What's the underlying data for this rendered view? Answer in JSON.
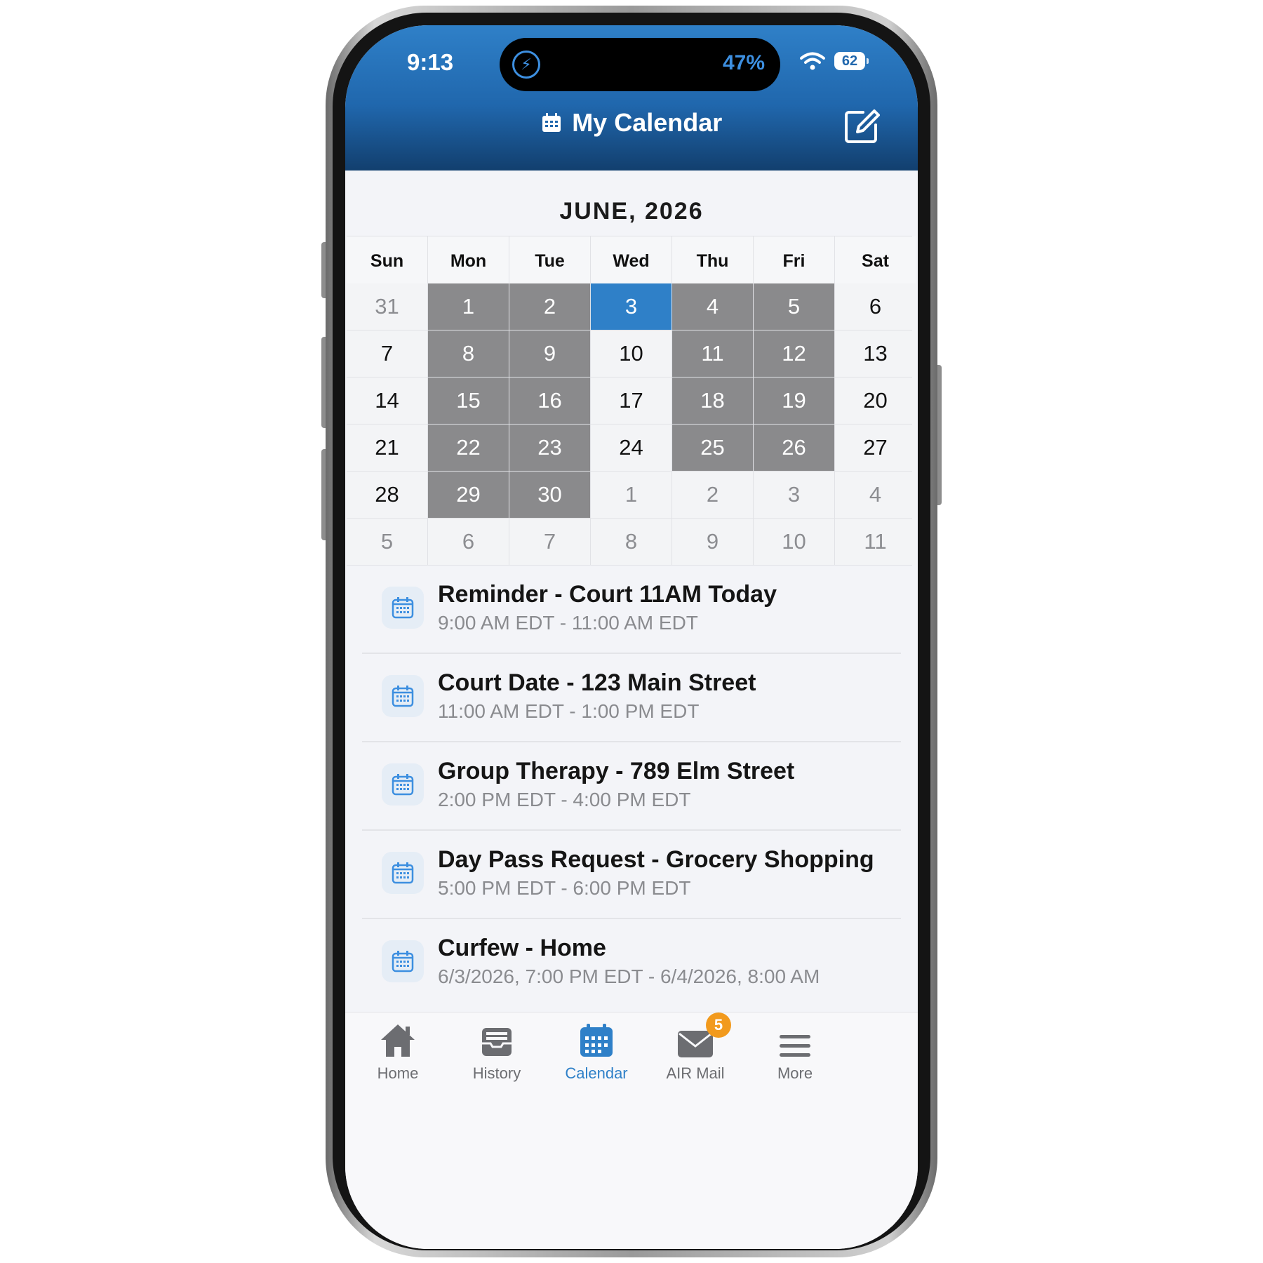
{
  "status": {
    "time": "9:13",
    "battery_pct": "47%",
    "battery_level": "62"
  },
  "header": {
    "title": "My Calendar"
  },
  "calendar": {
    "month": "JUNE, 2026",
    "weekdays": [
      "Sun",
      "Mon",
      "Tue",
      "Wed",
      "Thu",
      "Fri",
      "Sat"
    ],
    "weeks": [
      [
        {
          "d": "31",
          "s": "out"
        },
        {
          "d": "1",
          "s": "busy"
        },
        {
          "d": "2",
          "s": "busy"
        },
        {
          "d": "3",
          "s": "sel"
        },
        {
          "d": "4",
          "s": "busy"
        },
        {
          "d": "5",
          "s": "busy"
        },
        {
          "d": "6",
          "s": ""
        }
      ],
      [
        {
          "d": "7",
          "s": ""
        },
        {
          "d": "8",
          "s": "busy"
        },
        {
          "d": "9",
          "s": "busy"
        },
        {
          "d": "10",
          "s": ""
        },
        {
          "d": "11",
          "s": "busy"
        },
        {
          "d": "12",
          "s": "busy"
        },
        {
          "d": "13",
          "s": ""
        }
      ],
      [
        {
          "d": "14",
          "s": ""
        },
        {
          "d": "15",
          "s": "busy"
        },
        {
          "d": "16",
          "s": "busy"
        },
        {
          "d": "17",
          "s": ""
        },
        {
          "d": "18",
          "s": "busy"
        },
        {
          "d": "19",
          "s": "busy"
        },
        {
          "d": "20",
          "s": ""
        }
      ],
      [
        {
          "d": "21",
          "s": ""
        },
        {
          "d": "22",
          "s": "busy"
        },
        {
          "d": "23",
          "s": "busy"
        },
        {
          "d": "24",
          "s": ""
        },
        {
          "d": "25",
          "s": "busy"
        },
        {
          "d": "26",
          "s": "busy"
        },
        {
          "d": "27",
          "s": ""
        }
      ],
      [
        {
          "d": "28",
          "s": ""
        },
        {
          "d": "29",
          "s": "busy"
        },
        {
          "d": "30",
          "s": "busy"
        },
        {
          "d": "1",
          "s": "out"
        },
        {
          "d": "2",
          "s": "out"
        },
        {
          "d": "3",
          "s": "out"
        },
        {
          "d": "4",
          "s": "out"
        }
      ],
      [
        {
          "d": "5",
          "s": "out"
        },
        {
          "d": "6",
          "s": "out"
        },
        {
          "d": "7",
          "s": "out"
        },
        {
          "d": "8",
          "s": "out"
        },
        {
          "d": "9",
          "s": "out"
        },
        {
          "d": "10",
          "s": "out"
        },
        {
          "d": "11",
          "s": "out"
        }
      ]
    ]
  },
  "events": [
    {
      "title": "Reminder - Court 11AM Today",
      "time": "9:00 AM EDT - 11:00 AM EDT"
    },
    {
      "title": "Court Date - 123 Main Street",
      "time": "11:00 AM EDT - 1:00 PM EDT"
    },
    {
      "title": "Group Therapy - 789 Elm Street",
      "time": "2:00 PM EDT - 4:00 PM EDT"
    },
    {
      "title": "Day Pass Request - Grocery Shopping",
      "time": "5:00 PM EDT - 6:00 PM EDT"
    },
    {
      "title": "Curfew - Home",
      "time": "6/3/2026, 7:00 PM EDT - 6/4/2026, 8:00 AM"
    }
  ],
  "tabs": {
    "home": "Home",
    "history": "History",
    "calendar": "Calendar",
    "airmail": "AIR Mail",
    "airmail_badge": "5",
    "more": "More"
  },
  "colors": {
    "accent": "#2f80c8",
    "busy": "#8a8a8c",
    "badge": "#f29a1d"
  },
  "icons": [
    "calendar-icon",
    "edit-icon",
    "wifi-icon",
    "battery-icon",
    "home-icon",
    "history-icon",
    "mail-icon",
    "menu-icon"
  ]
}
